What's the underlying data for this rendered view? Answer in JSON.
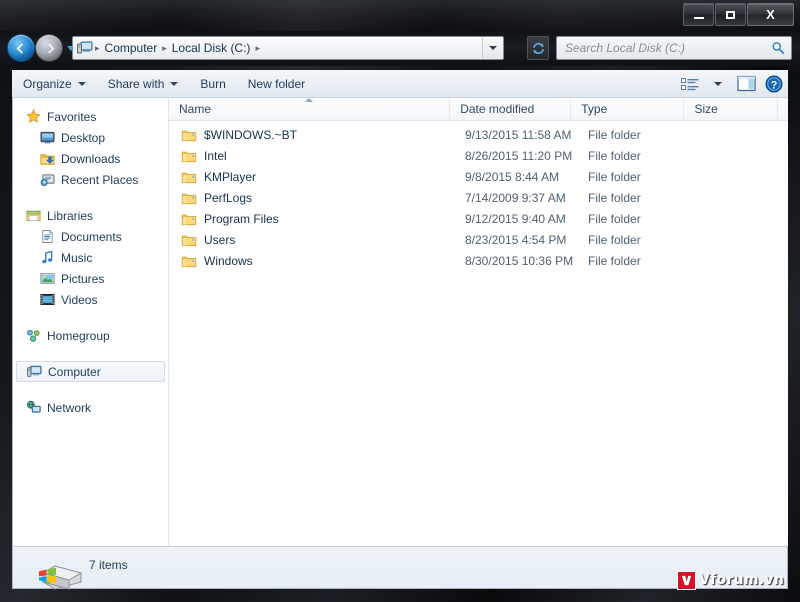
{
  "window": {
    "title": "",
    "controls": {
      "minimize": "Minimize",
      "maximize": "Maximize",
      "close": "Close"
    }
  },
  "address": {
    "crumbs": [
      "Computer",
      "Local Disk (C:)"
    ],
    "separator": "▸",
    "dropdown_label": "Previous locations",
    "refresh_label": "Refresh"
  },
  "search": {
    "placeholder": "Search Local Disk (C:)",
    "value": ""
  },
  "toolbar": {
    "organize": "Organize",
    "share_with": "Share with",
    "burn": "Burn",
    "new_folder": "New folder",
    "view_label": "Change your view",
    "preview_label": "Show the preview pane",
    "help_label": "Get help"
  },
  "navpane": {
    "groups": [
      {
        "header": {
          "label": "Favorites",
          "icon": "star-icon"
        },
        "items": [
          {
            "label": "Desktop",
            "icon": "desktop-icon"
          },
          {
            "label": "Downloads",
            "icon": "downloads-icon"
          },
          {
            "label": "Recent Places",
            "icon": "recent-places-icon"
          }
        ]
      },
      {
        "header": {
          "label": "Libraries",
          "icon": "libraries-icon"
        },
        "items": [
          {
            "label": "Documents",
            "icon": "documents-icon"
          },
          {
            "label": "Music",
            "icon": "music-icon"
          },
          {
            "label": "Pictures",
            "icon": "pictures-icon"
          },
          {
            "label": "Videos",
            "icon": "videos-icon"
          }
        ]
      },
      {
        "header": {
          "label": "Homegroup",
          "icon": "homegroup-icon"
        },
        "items": []
      },
      {
        "header": {
          "label": "Computer",
          "icon": "computer-icon",
          "selected": true
        },
        "items": []
      },
      {
        "header": {
          "label": "Network",
          "icon": "network-icon"
        },
        "items": []
      }
    ]
  },
  "list": {
    "columns": [
      {
        "key": "name",
        "label": "Name",
        "sorted": "asc"
      },
      {
        "key": "date",
        "label": "Date modified"
      },
      {
        "key": "type",
        "label": "Type"
      },
      {
        "key": "size",
        "label": "Size"
      }
    ],
    "rows": [
      {
        "name": "$WINDOWS.~BT",
        "date": "9/13/2015 11:58 AM",
        "type": "File folder",
        "size": ""
      },
      {
        "name": "Intel",
        "date": "8/26/2015 11:20 PM",
        "type": "File folder",
        "size": ""
      },
      {
        "name": "KMPlayer",
        "date": "9/8/2015 8:44 AM",
        "type": "File folder",
        "size": ""
      },
      {
        "name": "PerfLogs",
        "date": "7/14/2009 9:37 AM",
        "type": "File folder",
        "size": ""
      },
      {
        "name": "Program Files",
        "date": "9/12/2015 9:40 AM",
        "type": "File folder",
        "size": ""
      },
      {
        "name": "Users",
        "date": "8/23/2015 4:54 PM",
        "type": "File folder",
        "size": ""
      },
      {
        "name": "Windows",
        "date": "8/30/2015 10:36 PM",
        "type": "File folder",
        "size": ""
      }
    ]
  },
  "status": {
    "item_count": "7 items",
    "drive_icon": "local-disk-icon"
  },
  "watermark": {
    "text": "Vforum.vn",
    "logo_color": "#d8112a"
  },
  "colors": {
    "accent": "#2f8fd6",
    "folder": "#ffd165",
    "text": "#1f3b5c",
    "window_bg": "#ffffff"
  }
}
